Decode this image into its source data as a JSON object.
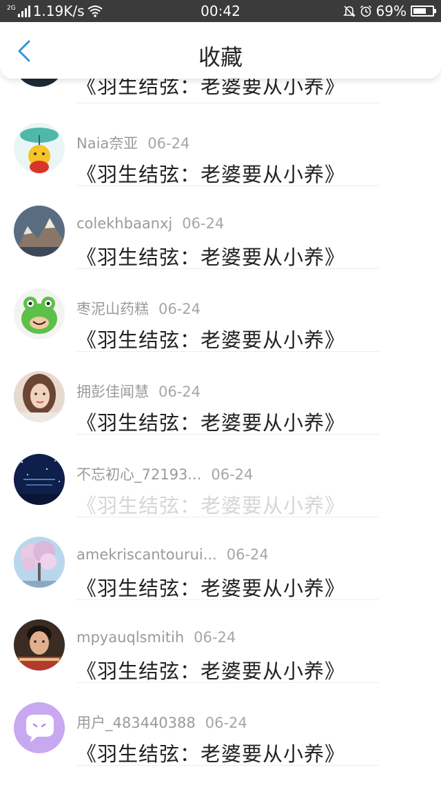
{
  "status_bar": {
    "network_type": "2G",
    "speed": "1.19K/s",
    "time": "00:42",
    "battery": "69%",
    "battery_level": 0.69,
    "icons": [
      "signal-icon",
      "wifi-icon",
      "mute-icon",
      "alarm-icon",
      "battery-icon"
    ]
  },
  "header": {
    "title": "收藏",
    "back_icon": "chevron-left-icon",
    "accent_color": "#2c96d8"
  },
  "items": [
    {
      "name": "",
      "date": "",
      "title": "《羽生结弦：老婆要从小养》",
      "avatar": "dark-avatar",
      "faded": false
    },
    {
      "name": "Naia奈亚",
      "date": "06-24",
      "title": "《羽生结弦：老婆要从小养》",
      "avatar": "bear-umbrella-avatar",
      "faded": false
    },
    {
      "name": "colekhbaanxj",
      "date": "06-24",
      "title": "《羽生结弦：老婆要从小养》",
      "avatar": "mountain-avatar",
      "faded": false
    },
    {
      "name": "枣泥山药糕",
      "date": "06-24",
      "title": "《羽生结弦：老婆要从小养》",
      "avatar": "frog-avatar",
      "faded": false
    },
    {
      "name": "拥彭佳闻慧",
      "date": "06-24",
      "title": "《羽生结弦：老婆要从小养》",
      "avatar": "portrait-avatar",
      "faded": false
    },
    {
      "name": "不忘初心_72193...",
      "date": "06-24",
      "title": "《羽生结弦：老婆要从小养》",
      "avatar": "night-sky-avatar",
      "faded": true
    },
    {
      "name": "amekriscantourui...",
      "date": "06-24",
      "title": "《羽生结弦：老婆要从小养》",
      "avatar": "blossom-tree-avatar",
      "faded": false
    },
    {
      "name": "mpyauqlsmitih",
      "date": "06-24",
      "title": "《羽生结弦：老婆要从小养》",
      "avatar": "boy-avatar",
      "faded": false
    },
    {
      "name": "用户_483440388",
      "date": "06-24",
      "title": "《羽生结弦：老婆要从小养》",
      "avatar": "chat-bubble-avatar",
      "faded": false
    }
  ]
}
